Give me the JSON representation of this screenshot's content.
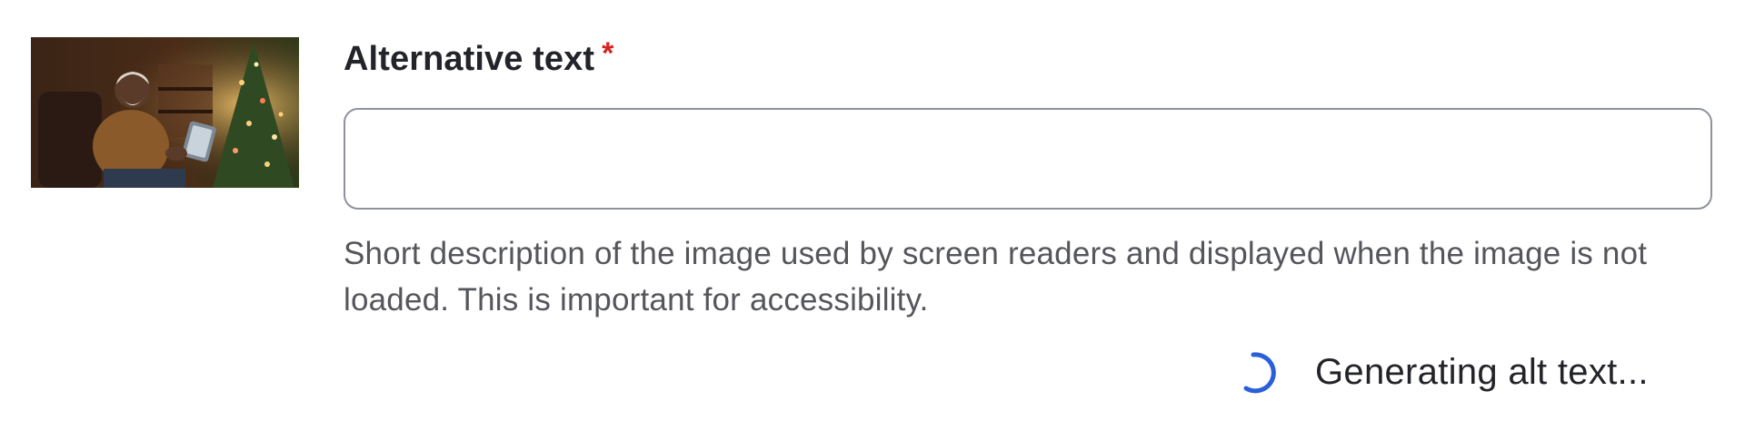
{
  "field": {
    "label": "Alternative text",
    "required_marker": "*",
    "value": "",
    "placeholder": "",
    "help_text": "Short description of the image used by screen readers and displayed when the image is not loaded. This is important for accessibility."
  },
  "status": {
    "text": "Generating alt text..."
  },
  "colors": {
    "required": "#d72222",
    "spinner": "#2b5fd9",
    "label": "#232429",
    "help": "#55565b",
    "border": "#8e929c"
  },
  "icons": {
    "spinner": "loading-spinner-icon"
  }
}
